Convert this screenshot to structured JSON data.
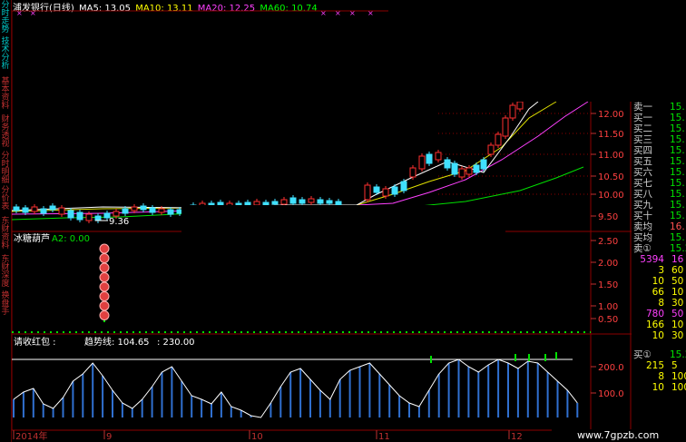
{
  "header": {
    "title": "浦发银行(日线)",
    "ma5": "MA5: 13.05",
    "ma10": "MA10: 13.11",
    "ma20": "MA20: 12.25",
    "ma60": "MA60: 10.74"
  },
  "sidebar": {
    "tabs": [
      {
        "label": "分时走势",
        "color": "#00c8c8"
      },
      {
        "label": "技术分析",
        "color": "#00c8c8"
      },
      {
        "label": "基本资料",
        "color": "#c03030"
      },
      {
        "label": "财务透视",
        "color": "#c03030"
      },
      {
        "label": "分时明细",
        "color": "#c03030"
      },
      {
        "label": "分价表",
        "color": "#c03030"
      },
      {
        "label": "东财资料",
        "color": "#c03030"
      },
      {
        "label": "东财深度",
        "color": "#c03030"
      },
      {
        "label": "换盘手",
        "color": "#c03030"
      }
    ]
  },
  "main_chart": {
    "y_ticks": [
      "12.00",
      "11.50",
      "11.00",
      "10.50",
      "10.00",
      "9.50"
    ],
    "low_label": "9.36"
  },
  "indicator1": {
    "title": "冰糖葫芦",
    "a2": "A2: 0.00",
    "y_ticks": [
      "2.50",
      "2.00",
      "1.50",
      "1.00",
      "0.50"
    ]
  },
  "indicator2": {
    "title": "请收红包 :",
    "trend": "趋势线: 104.65",
    "value": ": 230.00",
    "y_ticks": [
      "200.0",
      "100.0"
    ]
  },
  "x_axis": {
    "labels": [
      "2014年",
      "9",
      "10",
      "11",
      "12"
    ]
  },
  "right_panel": {
    "rows": [
      {
        "label": "卖一",
        "value": "15.",
        "color": "#00e000"
      },
      {
        "label": "买一",
        "value": "15.",
        "color": "#00e000"
      },
      {
        "label": "买二",
        "value": "15.",
        "color": "#00e000"
      },
      {
        "label": "买三",
        "value": "15.",
        "color": "#00e000"
      },
      {
        "label": "买四",
        "value": "15.",
        "color": "#00e000"
      },
      {
        "label": "买五",
        "value": "15.",
        "color": "#00e000"
      },
      {
        "label": "买六",
        "value": "15.",
        "color": "#00e000"
      },
      {
        "label": "买七",
        "value": "15.",
        "color": "#00e000"
      },
      {
        "label": "买八",
        "value": "15.",
        "color": "#00e000"
      },
      {
        "label": "买九",
        "value": "15.",
        "color": "#00e000"
      },
      {
        "label": "买十",
        "value": "15.",
        "color": "#00e000"
      },
      {
        "label": "卖均",
        "value": "16.",
        "color": "#ff5050"
      },
      {
        "label": "买均",
        "value": "15.",
        "color": "#00e000"
      },
      {
        "label": "卖①",
        "value": "15.2",
        "color": "#00e000"
      }
    ],
    "vol_rows": [
      {
        "a": "5394",
        "b": "16",
        "color": "#ff40ff"
      },
      {
        "a": "3",
        "b": "60",
        "color": "#ffff00"
      },
      {
        "a": "10",
        "b": "50",
        "color": "#ffff00"
      },
      {
        "a": "66",
        "b": "10",
        "color": "#ffff00"
      },
      {
        "a": "8",
        "b": "30",
        "color": "#ffff00"
      },
      {
        "a": "780",
        "b": "50",
        "color": "#ff40ff"
      },
      {
        "a": "166",
        "b": "10",
        "color": "#ffff00"
      },
      {
        "a": "10",
        "b": "30",
        "color": "#ffff00"
      }
    ],
    "bottom_rows": [
      {
        "label": "买①",
        "value": "15.2",
        "color": "#00e000"
      },
      {
        "a": "215",
        "b": "5",
        "color": "#ffff00"
      },
      {
        "a": "8",
        "b": "100",
        "color": "#ffff00"
      },
      {
        "a": "10",
        "b": "100",
        "color": "#ffff00"
      }
    ]
  },
  "watermark": "www.7gpzb.com"
}
